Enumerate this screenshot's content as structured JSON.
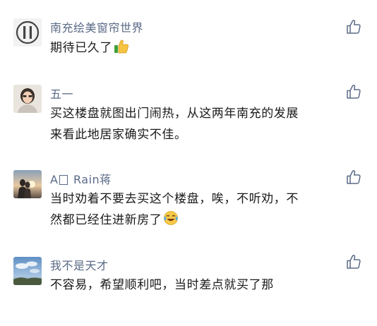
{
  "accent_color": "#5a6a86",
  "comments": [
    {
      "username": "南充绘美窗帘世界",
      "lines": [
        "期待已久了"
      ],
      "trailing_emoji": "thumbs-up-emoji",
      "avatar": "curtain-logo-avatar"
    },
    {
      "username": "五一",
      "lines": [
        "买这楼盘就图出门闹热，从这两年南充的发展",
        "来看此地居家确实不佳。"
      ],
      "avatar": "woman-portrait-avatar"
    },
    {
      "username_prefix": "A",
      "username_suffix": " Rain蒋",
      "lines": [
        "当时劝着不要去买这个楼盘，唉，不听劝，不",
        "然都已经住进新房了"
      ],
      "trailing_emoji": "crying-laughing-emoji",
      "avatar": "sunset-couple-avatar"
    },
    {
      "username": "我不是天才",
      "lines": [
        "不容易，希望顺利吧，当时差点就买了那"
      ],
      "avatar": "sky-landscape-avatar"
    }
  ]
}
